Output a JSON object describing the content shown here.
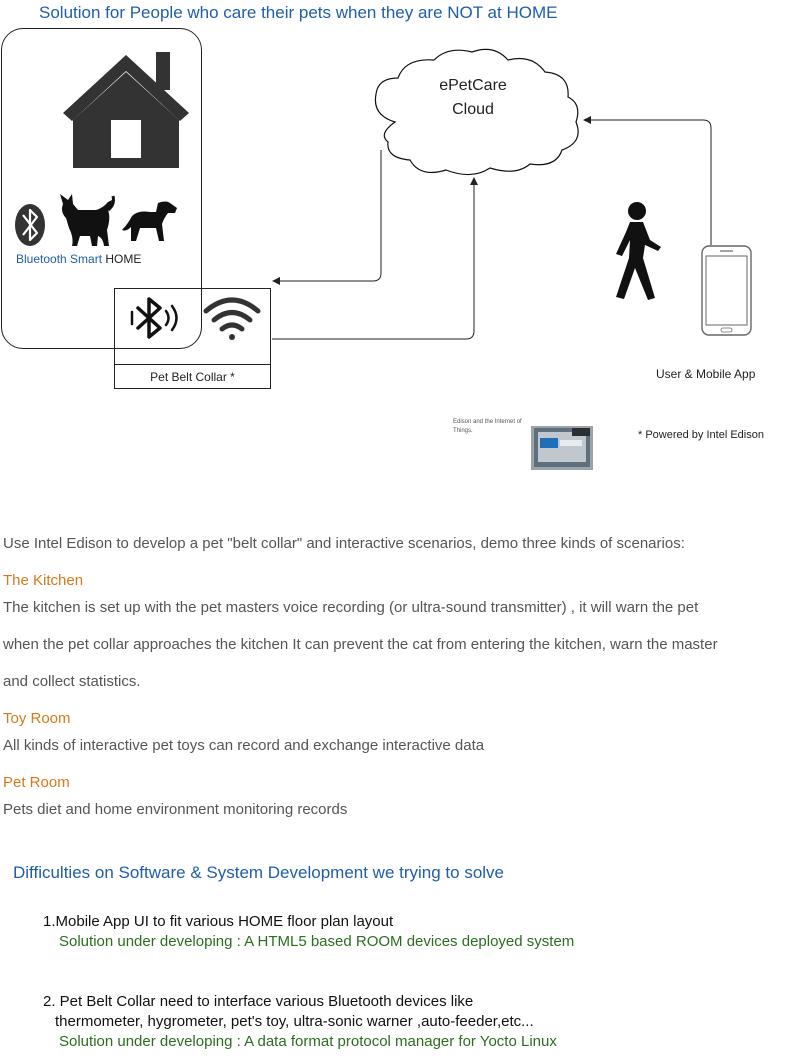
{
  "title": "Solution for People who care their pets when they are NOT at HOME",
  "home": {
    "bluetooth_label": "Bluetooth Smart",
    "home_label": "HOME"
  },
  "cloud": {
    "line1": "ePetCare",
    "line2": "Cloud"
  },
  "collar": {
    "label": "Pet Belt Collar *"
  },
  "user_label": "User & Mobile App",
  "edison": {
    "caption": "Edison and the Internet of Things.",
    "chip_text": "Intel Edison",
    "powered": "* Powered by Intel Edison"
  },
  "intro": "Use Intel Edison to develop a pet \"belt collar\" and interactive scenarios, demo three kinds of scenarios:",
  "scenarios": [
    {
      "heading": "The Kitchen",
      "lines": [
        "The kitchen is set up with the pet masters voice recording (or ultra-sound transmitter) , it will warn the pet",
        "when the pet collar approaches the kitchen It can prevent the cat from entering the kitchen, warn the master",
        "and collect statistics."
      ]
    },
    {
      "heading": "Toy Room",
      "lines": [
        "All kinds of interactive pet toys can record and exchange interactive data"
      ]
    },
    {
      "heading": "Pet Room",
      "lines": [
        "Pets diet and home environment monitoring records"
      ]
    }
  ],
  "difficulties": {
    "title": "Difficulties on Software & System Development  we trying to solve",
    "items": [
      {
        "lines": [
          "1.Mobile App UI to fit various HOME floor plan layout"
        ],
        "solution": "Solution under developing : A HTML5 based ROOM devices deployed system"
      },
      {
        "lines": [
          "2. Pet Belt Collar need to interface various Bluetooth devices like",
          "thermometer, hygrometer, pet's toy, ultra-sonic warner ,auto-feeder,etc..."
        ],
        "solution": "Solution under developing : A data format protocol manager for Yocto Linux"
      }
    ]
  },
  "icons": [
    "house-icon",
    "bluetooth-icon",
    "cat-icon",
    "dog-icon",
    "bluetooth-signal-icon",
    "wifi-icon",
    "walking-person-icon",
    "smartphone-icon",
    "intel-edison-chip-icon"
  ],
  "colors": {
    "title_blue": "#1f5ea8",
    "heading_orange": "#d57a1c",
    "solution_green": "#2a6e1e",
    "icon_dark": "#333333"
  }
}
